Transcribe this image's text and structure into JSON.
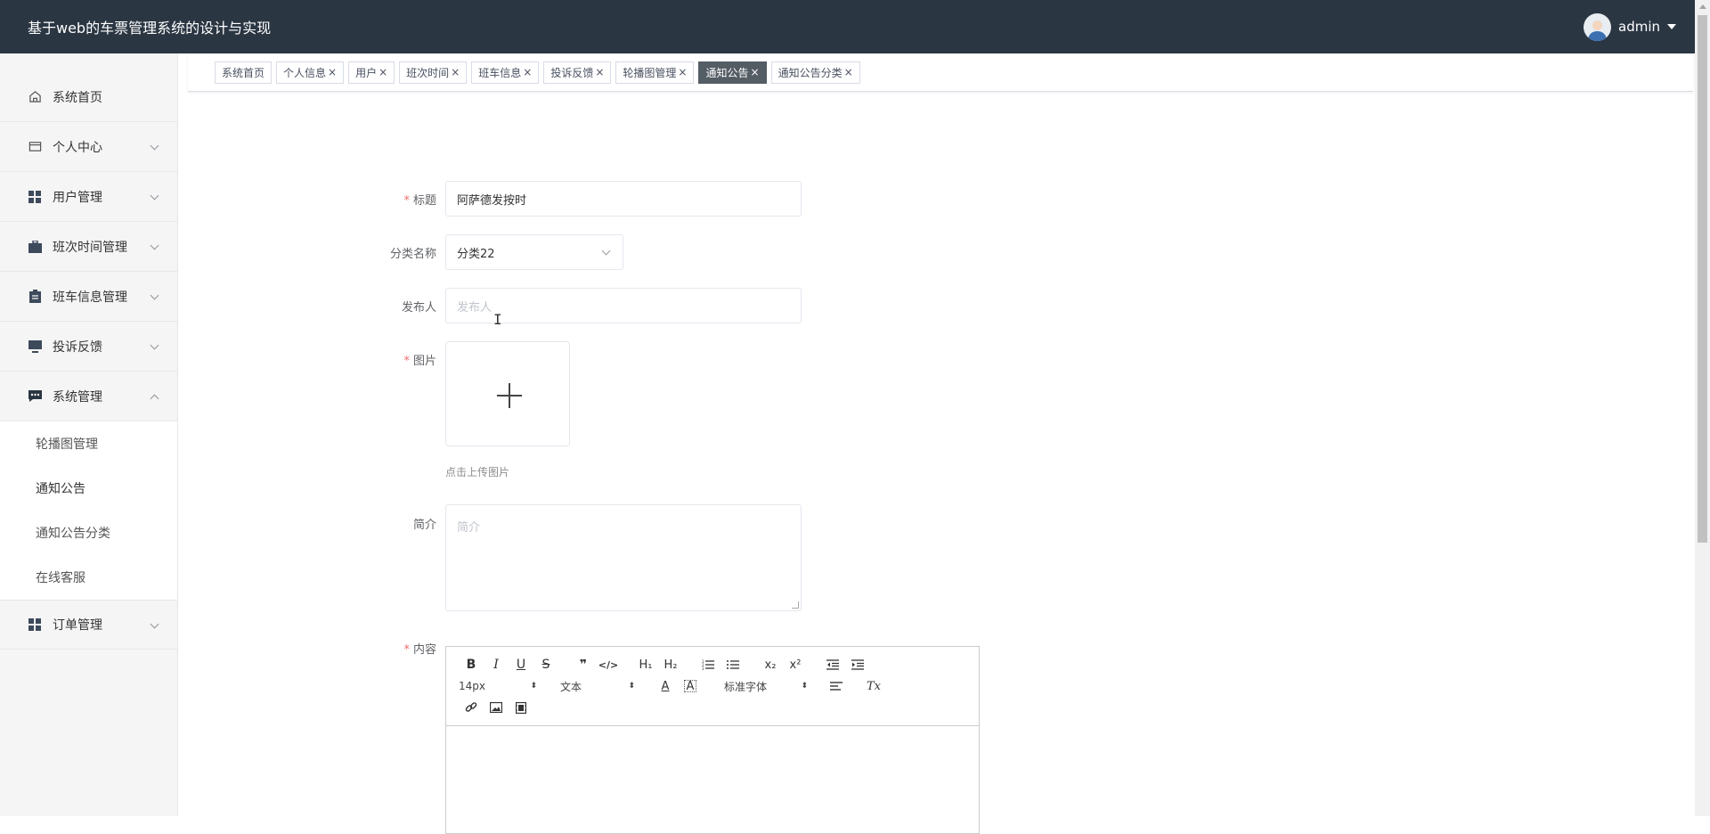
{
  "header": {
    "title": "基于web的车票管理系统的设计与实现",
    "username": "admin"
  },
  "sidebar": {
    "items": [
      {
        "label": "系统首页",
        "icon": "home-icon"
      },
      {
        "label": "个人中心",
        "icon": "wallet-icon"
      },
      {
        "label": "用户管理",
        "icon": "grid-icon"
      },
      {
        "label": "班次时间管理",
        "icon": "briefcase-icon"
      },
      {
        "label": "班车信息管理",
        "icon": "clipboard-icon"
      },
      {
        "label": "投诉反馈",
        "icon": "monitor-icon"
      },
      {
        "label": "系统管理",
        "icon": "chat-icon"
      },
      {
        "label": "订单管理",
        "icon": "grid-icon"
      }
    ],
    "submenu": [
      "轮播图管理",
      "通知公告",
      "通知公告分类",
      "在线客服"
    ]
  },
  "tags": [
    {
      "label": "系统首页"
    },
    {
      "label": "个人信息"
    },
    {
      "label": "用户"
    },
    {
      "label": "班次时间"
    },
    {
      "label": "班车信息"
    },
    {
      "label": "投诉反馈"
    },
    {
      "label": "轮播图管理"
    },
    {
      "label": "通知公告"
    },
    {
      "label": "通知公告分类"
    }
  ],
  "tag_close": "×",
  "form": {
    "required_mark": "*",
    "title_label": "标题",
    "title_value": "阿萨德发按时",
    "category_label": "分类名称",
    "category_value": "分类22",
    "publisher_label": "发布人",
    "publisher_placeholder": "发布人",
    "image_label": "图片",
    "upload_hint": "点击上传图片",
    "intro_label": "简介",
    "intro_placeholder": "简介",
    "content_label": "内容"
  },
  "editor": {
    "font_size": "14px",
    "header_type": "文本",
    "font_family": "标准字体",
    "btn_bold": "B",
    "btn_italic": "I",
    "btn_underline": "U",
    "btn_strike": "S",
    "btn_quote": "❞",
    "btn_code": "</>",
    "btn_h1": "H₁",
    "btn_h2": "H₂",
    "btn_sub": "x₂",
    "btn_sup": "x²",
    "btn_color": "A",
    "btn_bg": "A",
    "btn_clean": "Tx",
    "dropdown_glyph": "⬍"
  }
}
